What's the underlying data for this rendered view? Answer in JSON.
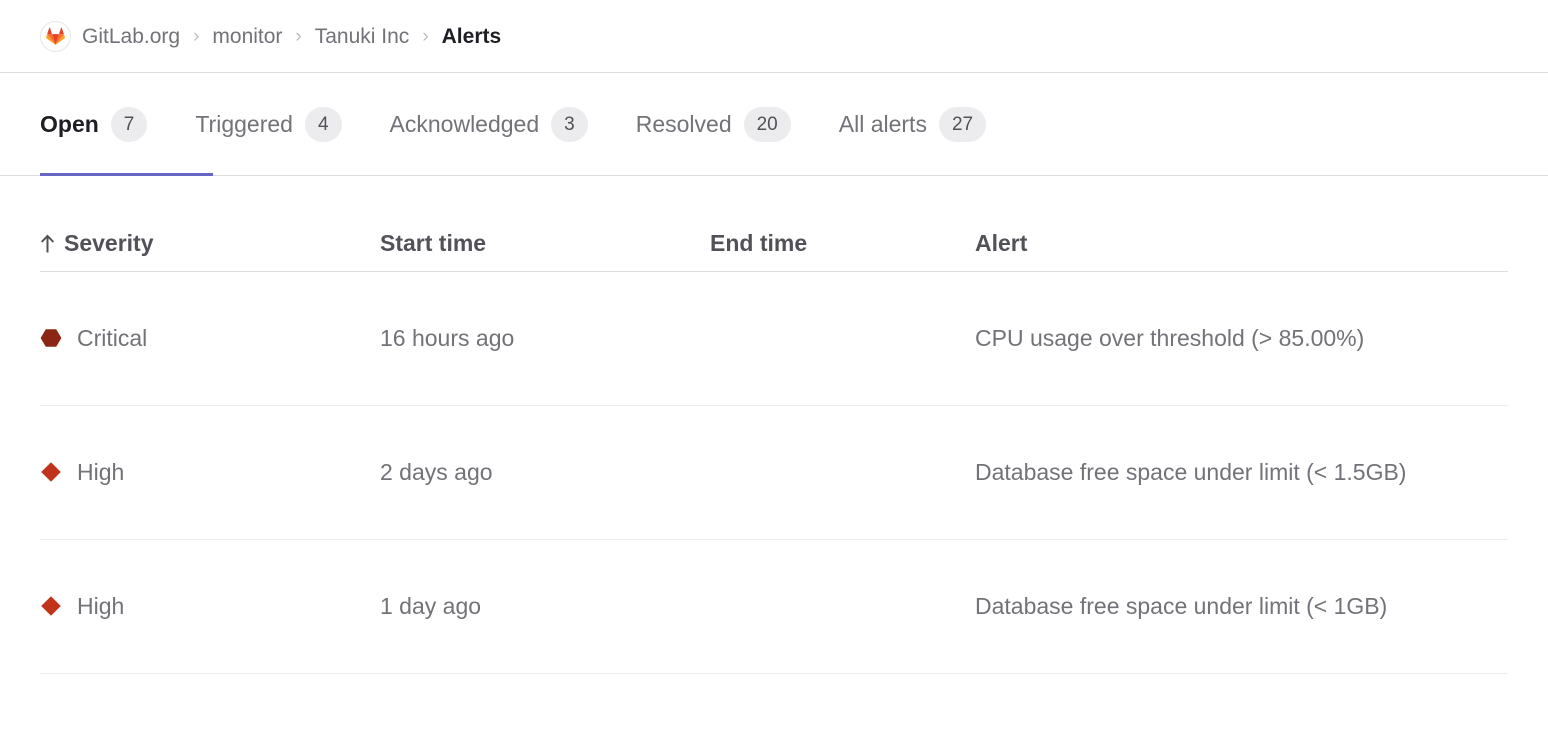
{
  "breadcrumb": {
    "avatar_icon": "gitlab-tanuki-icon",
    "separator": "›",
    "items": [
      {
        "label": "GitLab.org",
        "current": false
      },
      {
        "label": "monitor",
        "current": false
      },
      {
        "label": "Tanuki Inc",
        "current": false
      },
      {
        "label": "Alerts",
        "current": true
      }
    ]
  },
  "tabs": {
    "active_index": 0,
    "active_underline_color": "#6666c4",
    "items": [
      {
        "label": "Open",
        "count": "7"
      },
      {
        "label": "Triggered",
        "count": "4"
      },
      {
        "label": "Acknowledged",
        "count": "3"
      },
      {
        "label": "Resolved",
        "count": "20"
      },
      {
        "label": "All alerts",
        "count": "27"
      }
    ]
  },
  "table": {
    "sort_icon": "sort-ascending-arrow-icon",
    "sort_column": "Severity",
    "headers": {
      "severity": "Severity",
      "start_time": "Start time",
      "end_time": "End time",
      "alert": "Alert"
    },
    "rows": [
      {
        "severity": "Critical",
        "severity_icon": "severity-critical-hexagon-icon",
        "severity_color": "#8b2615",
        "start_time": "16 hours ago",
        "end_time": "",
        "alert": "CPU usage over threshold (> 85.00%)"
      },
      {
        "severity": "High",
        "severity_icon": "severity-high-diamond-icon",
        "severity_color": "#c1341b",
        "start_time": "2 days ago",
        "end_time": "",
        "alert": "Database free space under limit (< 1.5GB)"
      },
      {
        "severity": "High",
        "severity_icon": "severity-high-diamond-icon",
        "severity_color": "#c1341b",
        "start_time": "1 day ago",
        "end_time": "",
        "alert": "Database free space under limit (< 1GB)"
      }
    ]
  }
}
